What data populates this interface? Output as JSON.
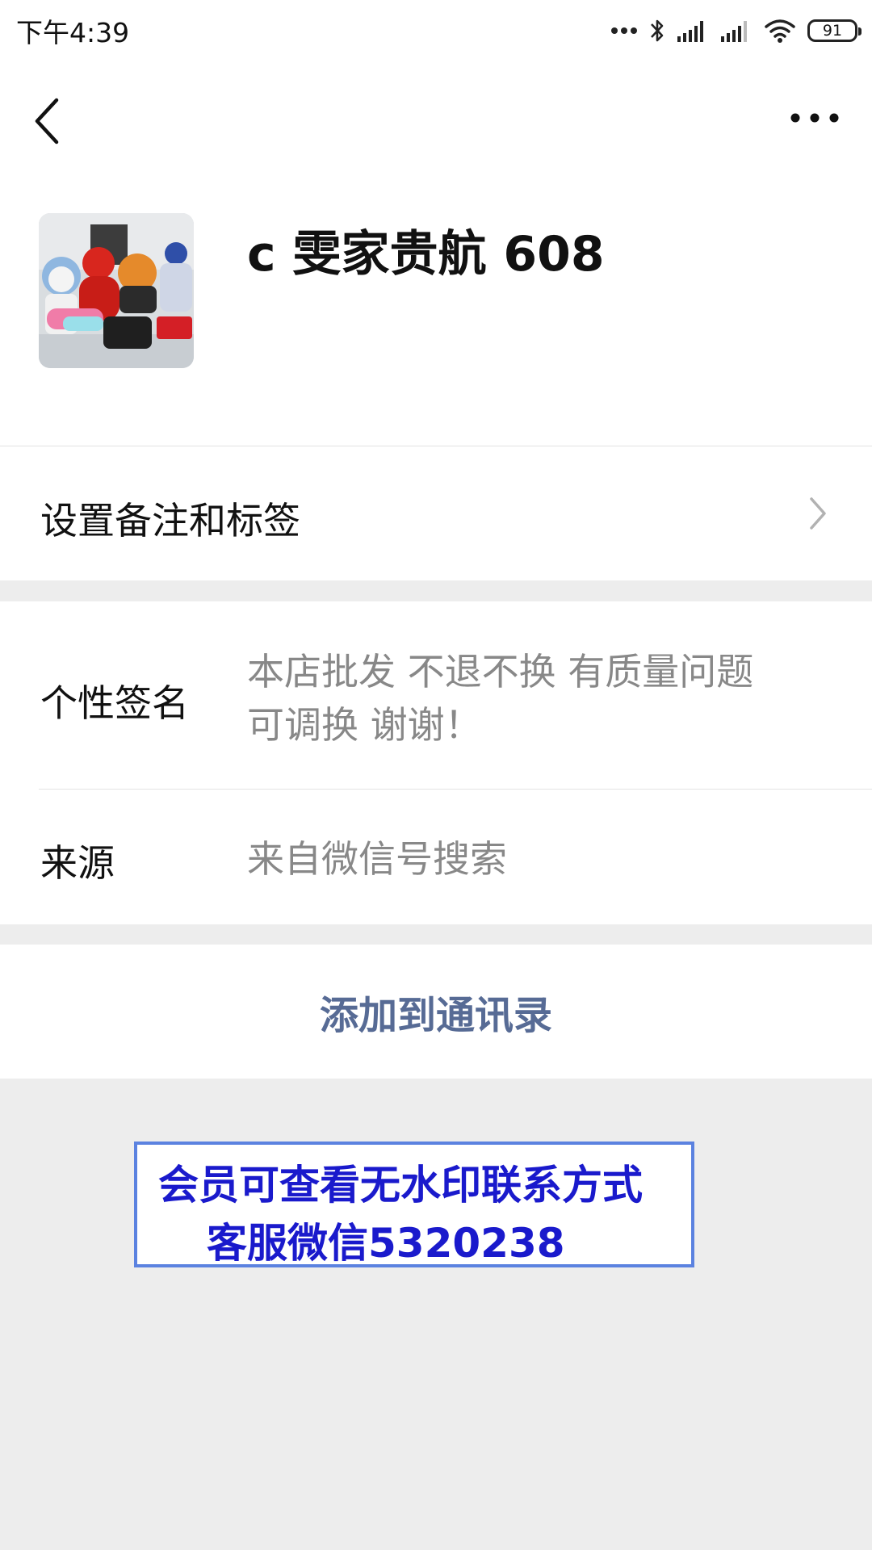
{
  "status_bar": {
    "time": "下午4:39",
    "icons": [
      "dots-icon",
      "bluetooth-icon",
      "signal-icon",
      "signal-icon",
      "wifi-icon",
      "battery-icon"
    ],
    "battery": "91"
  },
  "nav": {
    "back_icon": "chevron-left-icon",
    "more_icon": "more-dots-icon"
  },
  "profile": {
    "name": "c 雯家贵航 608",
    "avatar": "avatar-image"
  },
  "remark_row": {
    "label": "设置备注和标签",
    "icon": "chevron-right-icon"
  },
  "info": {
    "signature_label": "个性签名",
    "signature_line1": "本店批发 不退不换 有质量问题",
    "signature_line2": "可调换 谢谢！",
    "source_label": "来源",
    "source_value": "来自微信号搜索"
  },
  "actions": {
    "add_contact": "添加到通讯录"
  },
  "watermark": {
    "line1": "会员可查看无水印联系方式",
    "line2": "客服微信5320238"
  },
  "colors": {
    "link": "#576b95",
    "background": "#ededed",
    "watermark_text": "#1a1acc"
  }
}
